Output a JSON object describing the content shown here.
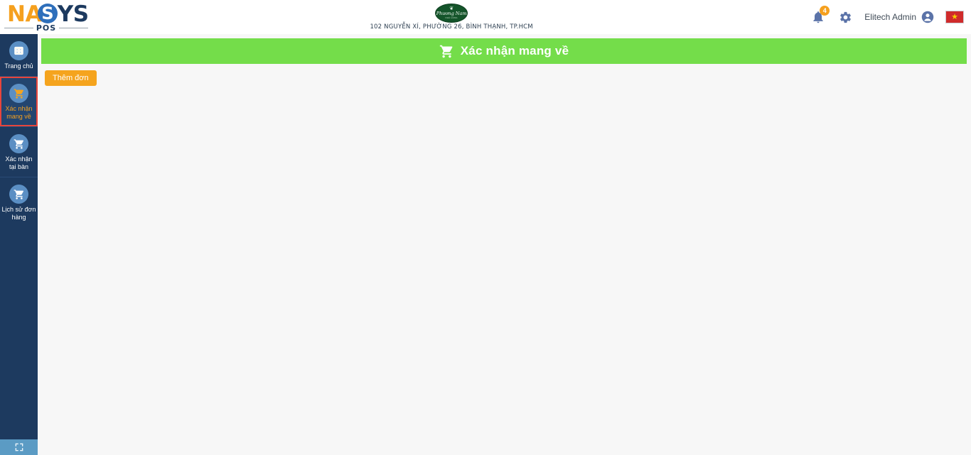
{
  "brand": {
    "part1": "NA",
    "circle_letter": "S",
    "part2": "YS",
    "subtitle": "POS"
  },
  "header": {
    "shop_logo": {
      "leaf_glyph": "❦",
      "name": "Phương Nam",
      "tagline": "NHÀ HÀNG"
    },
    "address": "102 NGUYỄN XÍ, PHƯỜNG 26, BÌNH THẠNH, TP.HCM",
    "notifications": {
      "icon": "bell-icon",
      "count": "4"
    },
    "settings_icon": "gear-icon",
    "user": {
      "name": "Elitech Admin",
      "avatar_icon": "user-avatar-icon"
    },
    "language": {
      "flag": "vietnam-flag",
      "star": "★"
    }
  },
  "sidebar": {
    "items": [
      {
        "label": "Trang chủ",
        "icon": "dashboard-icon",
        "active": false
      },
      {
        "label": "Xác nhận mang về",
        "icon": "cart-icon",
        "active": true
      },
      {
        "label": "Xác nhận tại bàn",
        "icon": "cart-icon",
        "active": false
      },
      {
        "label": "Lịch sử đơn hàng",
        "icon": "cart-icon",
        "active": false
      }
    ],
    "footer_icon": "fullscreen-expand-icon"
  },
  "main": {
    "banner": {
      "icon": "cart-icon",
      "title": "Xác nhận mang về"
    },
    "add_order_button": "Thêm đơn"
  },
  "colors": {
    "sidebar_bg": "#1d3a5f",
    "banner_green": "#74dd4a",
    "accent_orange": "#f5a41e",
    "active_border_red": "#e8453c",
    "brand_orange": "#f5a01e",
    "brand_navy": "#1d3a5f",
    "brand_blue": "#2e6fbb",
    "shop_green": "#14542a",
    "icon_circle_blue": "#5b8fc4",
    "content_bg": "#f7f7f7"
  }
}
